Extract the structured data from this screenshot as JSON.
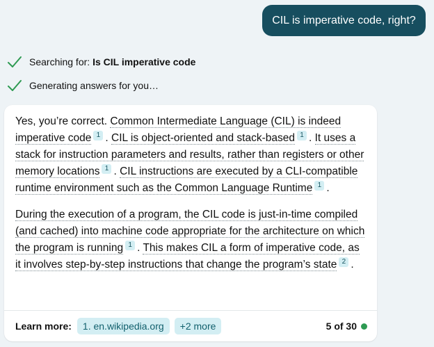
{
  "user_message": "CIL is imperative code, right?",
  "status": {
    "search_prefix": "Searching for: ",
    "search_query": "Is CIL imperative code",
    "generating": "Generating answers for you…",
    "check_color": "#2e9a52"
  },
  "answer": {
    "p1": {
      "t1": "Yes, you’re correct. ",
      "u1": "Common Intermediate Language (CIL) is indeed imperative code",
      "c1": "1",
      "t2": ". ",
      "u2": "CIL is object-oriented and stack-based",
      "c2": "1",
      "t3": ". ",
      "u3": "It uses a stack for instruction parameters and results, rather than registers or other memory locations",
      "c3": "1",
      "t4": ". ",
      "u4": "CIL instructions are executed by a CLI-compatible runtime environment such as the Common Language Runtime",
      "c4": "1",
      "t5": "."
    },
    "p2": {
      "u1": "During the execution of a program, the CIL code is just-in-time compiled (and cached) into machine code appropriate for the architecture on which the program is running",
      "c1": "1",
      "t1": ". ",
      "u2": "This makes CIL a form of imperative code, as it involves step-by-step instructions that change the program’s state",
      "c2": "2",
      "t2": "."
    }
  },
  "learn_more": {
    "label": "Learn more:",
    "link1": "1. en.wikipedia.org",
    "more": "+2 more",
    "count": "5 of 30"
  },
  "colors": {
    "user_bubble": "#174e5f",
    "chip_bg": "#d3eef3",
    "background": "#eef3f6"
  }
}
